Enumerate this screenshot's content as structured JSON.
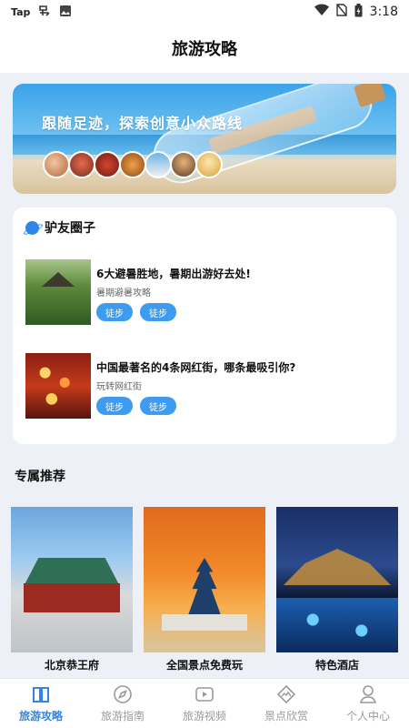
{
  "status_bar": {
    "left_app": "Tap",
    "time": "3:18",
    "icons": [
      "jd-icon",
      "image-icon",
      "wifi-icon",
      "no-sim-icon",
      "battery-icon"
    ]
  },
  "header": {
    "title": "旅游攻略"
  },
  "banner": {
    "text": "跟随足迹，探索创意小众路线",
    "avatar_count": 7
  },
  "circle": {
    "title": "驴友圈子",
    "posts": [
      {
        "title": "6大避暑胜地，暑期出游好去处!",
        "subtitle": "暑期避暑攻略",
        "tags": [
          "徒步",
          "徒步"
        ]
      },
      {
        "title": "中国最著名的4条网红街，哪条最吸引你?",
        "subtitle": "玩转网红街",
        "tags": [
          "徒步",
          "徒步"
        ]
      }
    ]
  },
  "recommend": {
    "title": "专属推荐",
    "items": [
      {
        "caption": "北京恭王府"
      },
      {
        "caption": "全国景点免费玩"
      },
      {
        "caption": "特色酒店"
      }
    ]
  },
  "tabs": [
    {
      "label": "旅游攻略",
      "icon": "book-icon",
      "active": true
    },
    {
      "label": "旅游指南",
      "icon": "compass-icon",
      "active": false
    },
    {
      "label": "旅游视频",
      "icon": "video-icon",
      "active": false
    },
    {
      "label": "景点欣赏",
      "icon": "scenery-icon",
      "active": false
    },
    {
      "label": "个人中心",
      "icon": "user-icon",
      "active": false
    }
  ],
  "colors": {
    "accent": "#2f86e8",
    "tag": "#3d9bf0",
    "background": "#edf0f6"
  }
}
